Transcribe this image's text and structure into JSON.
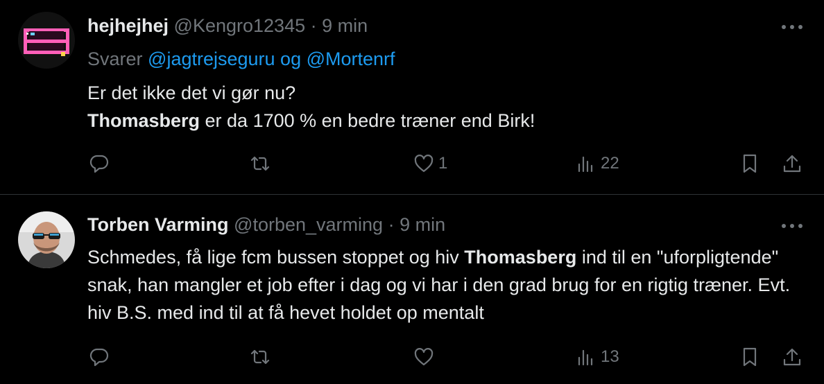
{
  "tweets": [
    {
      "name": "hejhejhej",
      "handle": "@Kengro12345",
      "separator": "·",
      "time": "9 min",
      "reply_prefix": "Svarer",
      "reply_mentions": "@jagtrejseguru og @Mortenrf",
      "lines": [
        {
          "bold": "",
          "text": "Er det ikke det vi gør nu?"
        },
        {
          "bold": "Thomasberg",
          "text": " er da 1700 % en bedre træner end Birk!"
        }
      ],
      "likes": "1",
      "views": "22",
      "avatar_icon": "pixel-art-avatar"
    },
    {
      "name": "Torben Varming",
      "handle": "@torben_varming",
      "separator": "·",
      "time": "9 min",
      "text_pre": "Schmedes, få lige fcm bussen stoppet og hiv ",
      "text_bold": "Thomasberg",
      "text_post": " ind til en \"uforpligtende\" snak, han mangler et job efter i dag og vi har i den grad brug for en rigtig træner. Evt. hiv B.S. med ind til at få hevet holdet op mentalt",
      "likes": "",
      "views": "13",
      "avatar_icon": "photo-avatar"
    }
  ],
  "colors": {
    "background": "#000000",
    "text": "#e7e9ea",
    "muted": "#71767b",
    "link": "#1d9bf0",
    "divider": "#2f3336"
  }
}
